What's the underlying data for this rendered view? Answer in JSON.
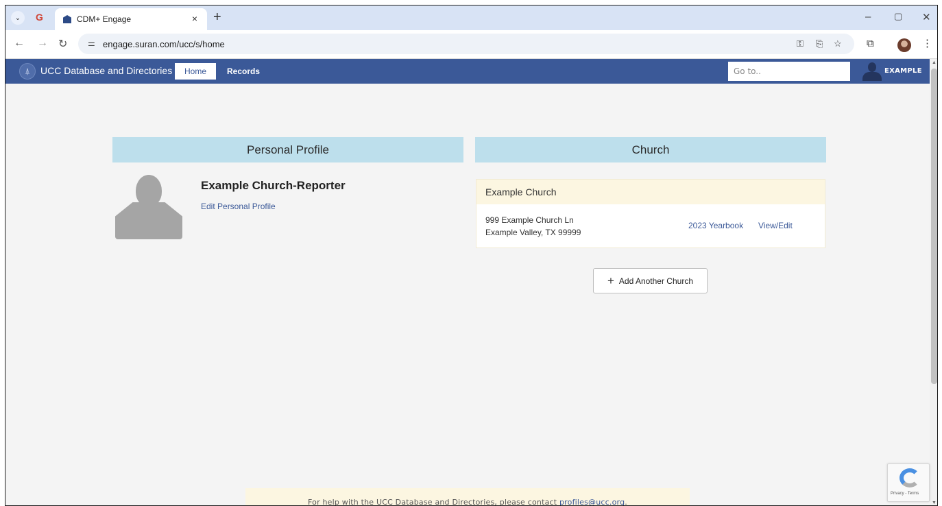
{
  "browser": {
    "tab_title": "CDM+ Engage",
    "tab_close": "×",
    "new_tab": "+",
    "url": "engage.suran.com/ucc/s/home",
    "window_controls": {
      "minimize": "–",
      "maximize": "▢",
      "close": "✕"
    }
  },
  "site": {
    "title": "UCC Database and Directories",
    "nav": {
      "home": "Home",
      "records": "Records"
    },
    "goto_placeholder": "Go to..",
    "user_name": "EXAMPLE",
    "accent_color": "#3b5998"
  },
  "personal_profile": {
    "header": "Personal Profile",
    "name": "Example Church-Reporter",
    "edit_link": "Edit Personal Profile"
  },
  "church": {
    "header": "Church",
    "card": {
      "name": "Example Church",
      "address_line1": "999 Example Church Ln",
      "address_line2": "Example Valley, TX 99999",
      "yearbook_link": "2023 Yearbook",
      "view_edit_link": "View/Edit"
    },
    "add_button": "Add Another Church"
  },
  "footer": {
    "help_text": "For help with the UCC Database and Directories, please contact ",
    "email": "profiles@ucc.org",
    "help_suffix": "."
  },
  "recaptcha": {
    "text": "Privacy - Terms"
  },
  "icons": [
    "tab-dropdown-icon",
    "google-icon",
    "back-icon",
    "forward-icon",
    "reload-icon",
    "site-settings-icon",
    "password-key-icon",
    "install-app-icon",
    "bookmark-star-icon",
    "extensions-icon",
    "menu-dots-icon",
    "ucc-logo-icon",
    "user-avatar-icon",
    "plus-icon",
    "recaptcha-icon"
  ]
}
